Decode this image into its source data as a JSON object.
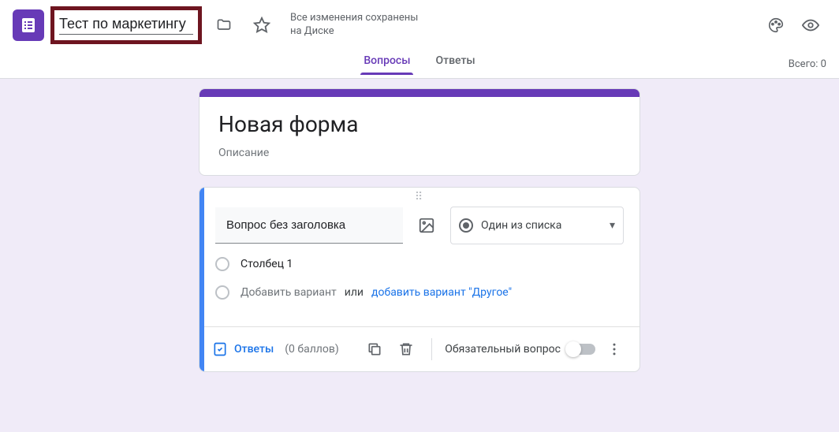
{
  "header": {
    "form_title": "Тест по маркетингу",
    "save_status": "Все изменения сохранены на Диске"
  },
  "tabs": {
    "questions": "Вопросы",
    "responses": "Ответы",
    "total_label": "Всего: 0"
  },
  "title_card": {
    "title": "Новая форма",
    "description": "Описание"
  },
  "question_card": {
    "question_text": "Вопрос без заголовка",
    "type_label": "Один из списка",
    "options": [
      {
        "label": "Столбец 1"
      }
    ],
    "add_option": "Добавить вариант",
    "or": "или",
    "add_other": "добавить вариант \"Другое\"",
    "answer_key": "Ответы",
    "points": "(0 баллов)",
    "required_label": "Обязательный вопрос"
  }
}
